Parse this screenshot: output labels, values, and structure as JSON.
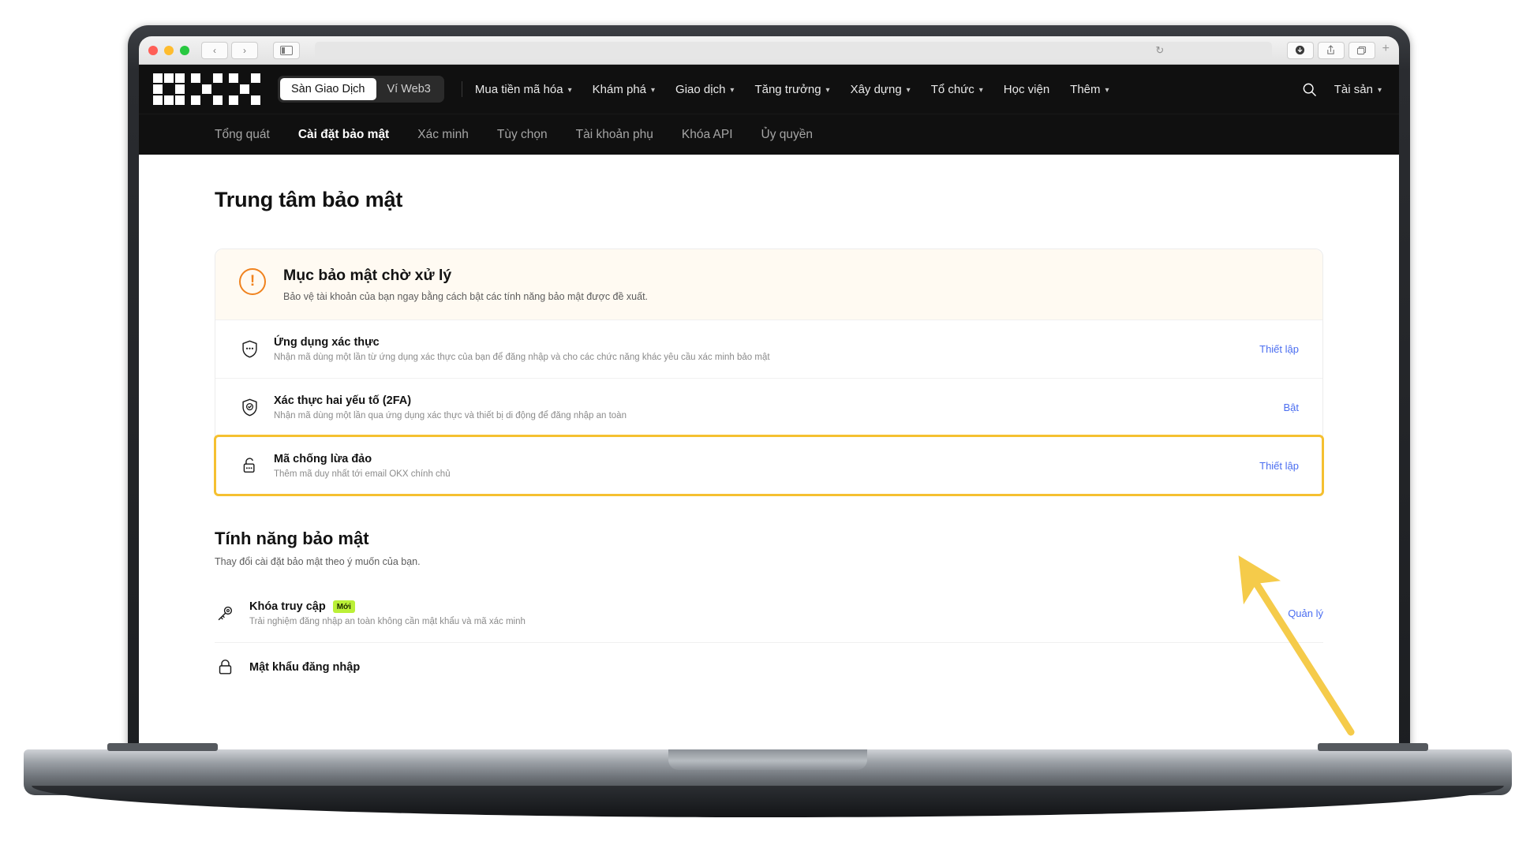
{
  "browser": {
    "traffic_lights": [
      "close",
      "minimize",
      "maximize"
    ],
    "back_label": "‹",
    "forward_label": "›",
    "sidebar_icon": "sidebar-icon",
    "url_value": "",
    "url_placeholder": "",
    "reload_icon": "reload-icon",
    "download_icon": "download-icon",
    "share_icon": "share-icon",
    "tabs_icon": "tabs-icon",
    "new_tab_label": "+"
  },
  "topnav": {
    "logo_alt": "OKX",
    "segments": [
      {
        "label": "Sàn Giao Dịch",
        "active": true
      },
      {
        "label": "Ví Web3",
        "active": false
      }
    ],
    "menu": [
      {
        "label": "Mua tiền mã hóa",
        "has_caret": true
      },
      {
        "label": "Khám phá",
        "has_caret": true
      },
      {
        "label": "Giao dịch",
        "has_caret": true
      },
      {
        "label": "Tăng trưởng",
        "has_caret": true
      },
      {
        "label": "Xây dựng",
        "has_caret": true
      },
      {
        "label": "Tổ chức",
        "has_caret": true
      },
      {
        "label": "Học viện",
        "has_caret": false
      },
      {
        "label": "Thêm",
        "has_caret": true
      }
    ],
    "search_icon": "search-icon",
    "assets_label": "Tài sản",
    "assets_has_caret": true,
    "caret_glyph": "⌄"
  },
  "subnav": {
    "items": [
      {
        "label": "Tổng quát",
        "active": false
      },
      {
        "label": "Cài đặt bảo mật",
        "active": true
      },
      {
        "label": "Xác minh",
        "active": false
      },
      {
        "label": "Tùy chọn",
        "active": false
      },
      {
        "label": "Tài khoản phụ",
        "active": false
      },
      {
        "label": "Khóa API",
        "active": false
      },
      {
        "label": "Ủy quyền",
        "active": false
      }
    ]
  },
  "page": {
    "title": "Trung tâm bảo mật",
    "pending": {
      "warn_glyph": "!",
      "title": "Mục bảo mật chờ xử lý",
      "subtitle": "Bảo vệ tài khoản của bạn ngay bằng cách bật các tính năng bảo mật được đề xuất.",
      "rows": [
        {
          "icon": "shield-dots-icon",
          "title": "Ứng dụng xác thực",
          "desc": "Nhận mã dùng một lần từ ứng dụng xác thực của bạn để đăng nhập và cho các chức năng khác yêu cầu xác minh bảo mật",
          "action": "Thiết lập",
          "highlighted": false
        },
        {
          "icon": "shield-check-icon",
          "title": "Xác thực hai yếu tố (2FA)",
          "desc": "Nhận mã dùng một lần qua ứng dụng xác thực và thiết bị di động để đăng nhập an toàn",
          "action": "Bật",
          "highlighted": false
        },
        {
          "icon": "lock-dots-icon",
          "title": "Mã chống lừa đảo",
          "desc": "Thêm mã duy nhất tới email OKX chính chủ",
          "action": "Thiết lập",
          "highlighted": true
        }
      ]
    },
    "features": {
      "title": "Tính năng bảo mật",
      "subtitle": "Thay đổi cài đặt bảo mật theo ý muốn của bạn.",
      "rows": [
        {
          "icon": "key-icon",
          "title": "Khóa truy cập",
          "badge": "Mới",
          "desc": "Trải nghiệm đăng nhập an toàn không cần mật khẩu và mã xác minh",
          "action": "Quản lý",
          "highlighted": false
        },
        {
          "icon": "lock-icon",
          "title": "Mật khẩu đăng nhập",
          "badge": "",
          "desc": "",
          "action": "",
          "highlighted": false
        }
      ]
    }
  },
  "annotation": {
    "arrow_color": "#f5cb4a",
    "highlight_color": "#f5c030",
    "link_color": "#4a6df0",
    "badge_color": "#bbf037",
    "warning_color": "#f0821e"
  }
}
